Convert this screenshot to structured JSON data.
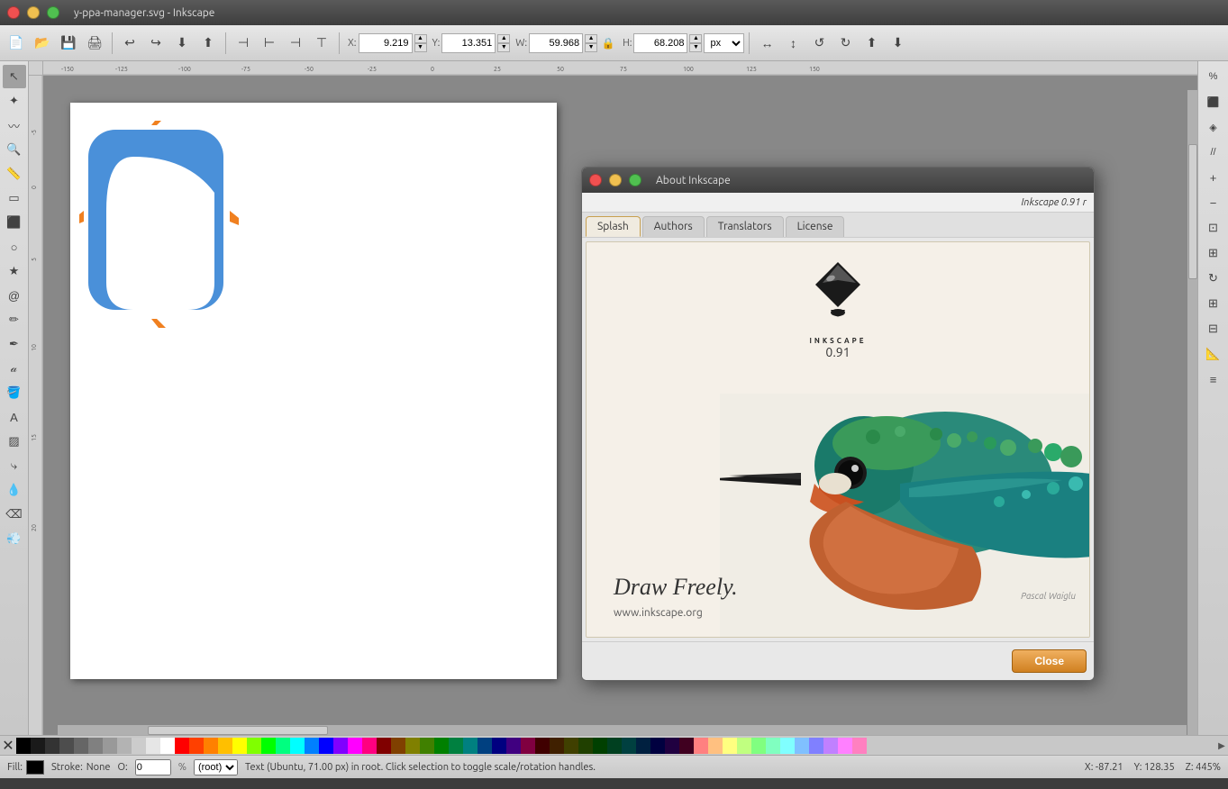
{
  "window": {
    "title": "y-ppa-manager.svg - Inkscape",
    "close_btn": "×",
    "min_btn": "−",
    "max_btn": "□"
  },
  "toolbar": {
    "x_label": "X:",
    "x_value": "9.219",
    "y_label": "Y:",
    "y_value": "13.351",
    "w_label": "W:",
    "w_value": "59.968",
    "h_label": "H:",
    "h_value": "68.208",
    "unit": "px"
  },
  "about_dialog": {
    "title": "About Inkscape",
    "version_text": "Inkscape 0.91 r",
    "tabs": [
      {
        "label": "Splash",
        "active": true
      },
      {
        "label": "Authors",
        "active": false
      },
      {
        "label": "Translators",
        "active": false
      },
      {
        "label": "License",
        "active": false
      }
    ],
    "inkscape_name": "INKSCAPE",
    "version": "0.91",
    "draw_freely": "Draw Freely.",
    "url": "www.inkscape.org",
    "artist_sig": "Pascal Waiglu",
    "close_label": "Close"
  },
  "statusbar": {
    "fill_label": "Fill:",
    "stroke_label": "Stroke:",
    "stroke_value": "None",
    "opacity_label": "O:",
    "opacity_value": "0",
    "context_label": "(root)",
    "status_text": "Text  (Ubuntu, 71.00 px) in root. Click selection to toggle scale/rotation handles.",
    "x_coord": "X: -87.21",
    "y_coord": "Y: 128.35",
    "z_level": "Z: 445%"
  },
  "palette": {
    "colors": [
      "#000000",
      "#1a1a1a",
      "#333333",
      "#4d4d4d",
      "#666666",
      "#808080",
      "#999999",
      "#b3b3b3",
      "#cccccc",
      "#e6e6e6",
      "#ffffff",
      "#ff0000",
      "#ff4000",
      "#ff8000",
      "#ffbf00",
      "#ffff00",
      "#80ff00",
      "#00ff00",
      "#00ff80",
      "#00ffff",
      "#0080ff",
      "#0000ff",
      "#8000ff",
      "#ff00ff",
      "#ff0080",
      "#800000",
      "#804000",
      "#808000",
      "#408000",
      "#008000",
      "#008040",
      "#008080",
      "#004080",
      "#000080",
      "#400080",
      "#800040",
      "#400000",
      "#402000",
      "#404000",
      "#204000",
      "#004000",
      "#004020",
      "#004040",
      "#002040",
      "#000040",
      "#200040",
      "#400020",
      "#ff8080",
      "#ffc080",
      "#ffff80",
      "#c0ff80",
      "#80ff80",
      "#80ffc0",
      "#80ffff",
      "#80c0ff",
      "#8080ff",
      "#c080ff",
      "#ff80ff",
      "#ff80c0"
    ]
  }
}
